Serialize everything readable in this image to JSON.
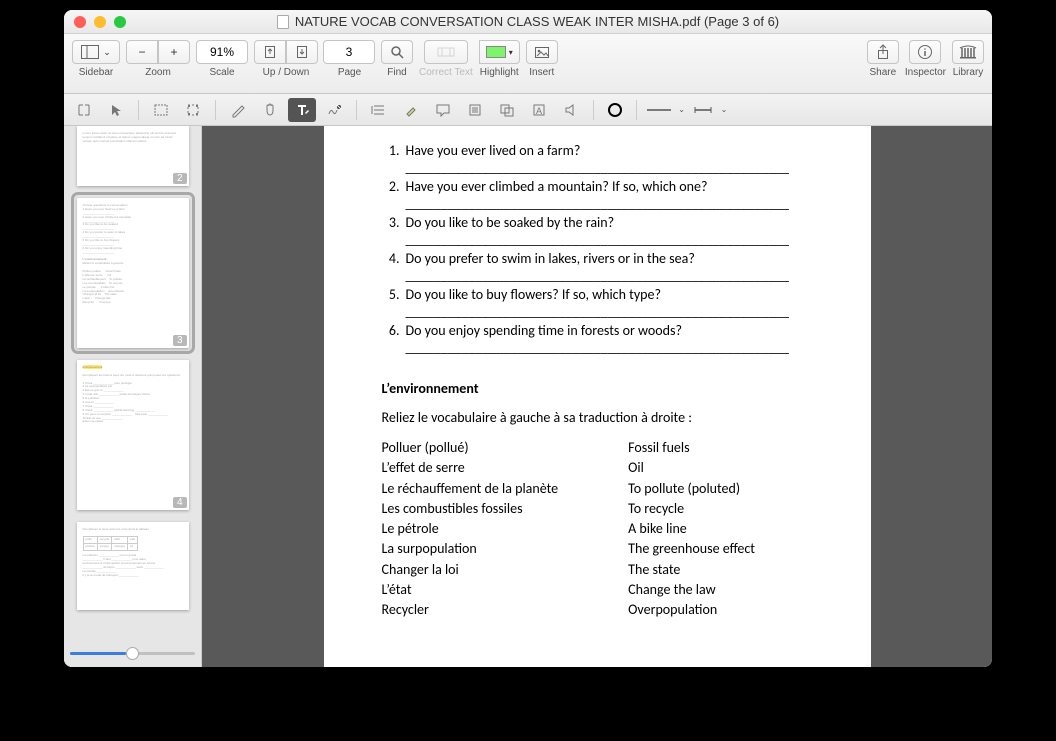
{
  "title": "NATURE VOCAB CONVERSATION CLASS WEAK INTER MISHA.pdf (Page 3 of 6)",
  "toolbar": {
    "sidebar": "Sidebar",
    "zoom": "Zoom",
    "zoomValue": "91%",
    "scale": "Scale",
    "updown": "Up / Down",
    "page": "Page",
    "pageValue": "3",
    "find": "Find",
    "correct": "Correct Text",
    "highlight": "Highlight",
    "insert": "Insert",
    "share": "Share",
    "inspector": "Inspector",
    "library": "Library"
  },
  "thumbs": {
    "badges": [
      "2",
      "3",
      "4"
    ]
  },
  "doc": {
    "questions": [
      "Have you ever lived on a farm?",
      "Have you ever climbed a mountain? If so, which one?",
      "Do you like to be soaked by the rain?",
      "Do you prefer to swim in lakes, rivers or in the sea?",
      "Do you like to buy flowers? If so, which type?",
      "Do you enjoy spending time in forests or woods?"
    ],
    "blank": "_______________________________________________________",
    "sectionTitle": "L’environnement",
    "instruction": "Reliez le vocabulaire à gauche à sa traduction à droite :",
    "leftCol": [
      "Polluer (pollué)",
      "L’effet de serre",
      "Le réchauffement de la planète",
      "Les combustibles fossiles",
      "Le pétrole",
      "La surpopulation",
      "Changer la loi",
      "L’état",
      "Recycler"
    ],
    "rightCol": [
      "Fossil fuels",
      "Oil",
      "To pollute (poluted)",
      "To recycle",
      "A bike line",
      "The greenhouse effect",
      "The state",
      "Change the law",
      "Overpopulation"
    ]
  }
}
